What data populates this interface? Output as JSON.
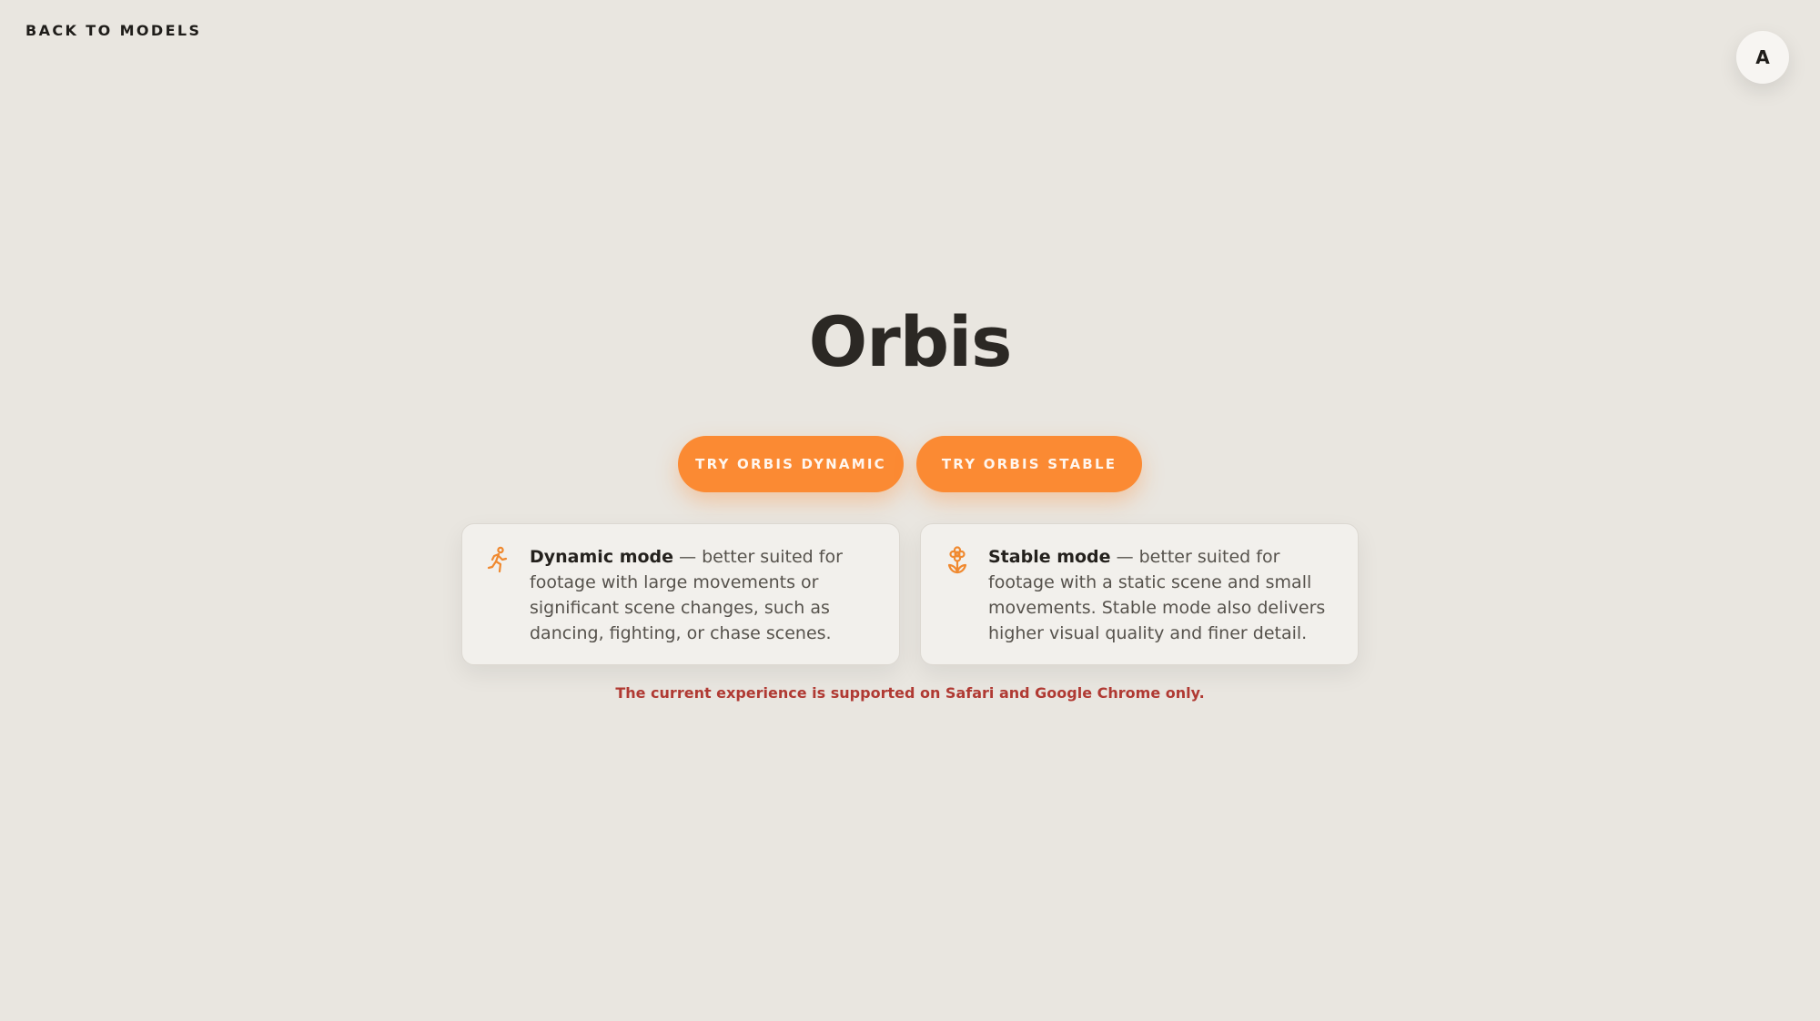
{
  "nav": {
    "back_label": "BACK TO MODELS"
  },
  "user": {
    "avatar_initial": "A"
  },
  "page": {
    "title": "Orbis"
  },
  "actions": {
    "dynamic_label": "TRY ORBIS DYNAMIC",
    "stable_label": "TRY ORBIS STABLE"
  },
  "modes": {
    "dynamic": {
      "icon": "running-person-icon",
      "name": "Dynamic mode",
      "description": " — better suited for footage with large movements or significant scene changes, such as dancing, fighting, or chase scenes."
    },
    "stable": {
      "icon": "flower-icon",
      "name": "Stable mode",
      "description": " — better suited for footage with a static scene and small movements. Stable mode also delivers higher visual quality and finer detail."
    }
  },
  "notice": {
    "support_text": "The current experience is supported on Safari and Google Chrome only."
  },
  "colors": {
    "background": "#e9e6e0",
    "accent": "#fb8a33",
    "warning": "#b03a33"
  }
}
